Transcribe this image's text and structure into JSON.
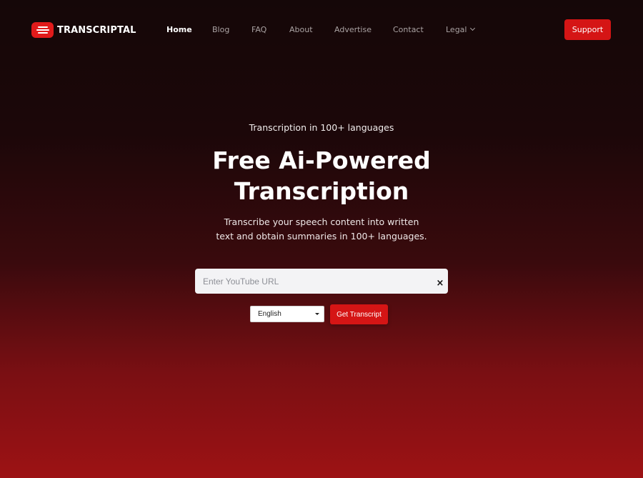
{
  "header": {
    "brand": "TRANSCRIPTAL",
    "nav": [
      {
        "label": "Home",
        "active": true
      },
      {
        "label": "Blog",
        "active": false
      },
      {
        "label": "FAQ",
        "active": false
      },
      {
        "label": "About",
        "active": false
      },
      {
        "label": "Advertise",
        "active": false
      },
      {
        "label": "Contact",
        "active": false
      },
      {
        "label": "Legal",
        "active": false,
        "dropdown": true
      }
    ],
    "support_label": "Support"
  },
  "hero": {
    "kicker": "Transcription in 100+ languages",
    "title_line1": "Free Ai-Powered",
    "title_line2": "Transcription",
    "subtitle_line1": "Transcribe your speech content into written",
    "subtitle_line2": "text and obtain summaries in 100+ languages."
  },
  "form": {
    "url_placeholder": "Enter YouTube URL",
    "url_value": "",
    "clear_glyph": "×",
    "language_selected": "English",
    "submit_label": "Get Transcript"
  },
  "colors": {
    "accent": "#d51515",
    "logo": "#e11b1b",
    "background_top": "#150708",
    "background_bottom": "#9d1214"
  }
}
